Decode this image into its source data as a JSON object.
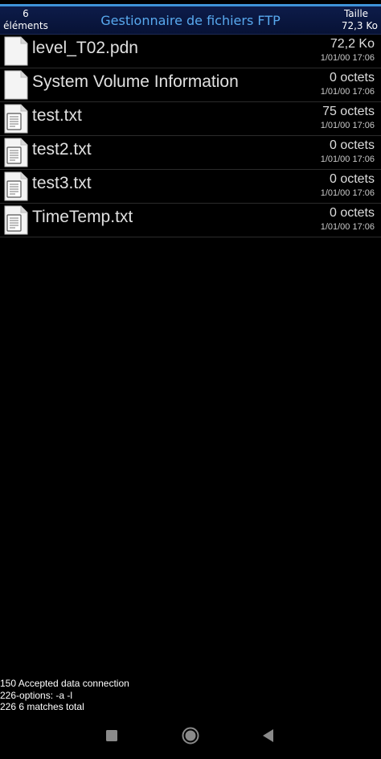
{
  "header": {
    "count_value": "6",
    "count_label": "éléments",
    "title": "Gestionnaire de fichiers FTP",
    "size_label": "Taille",
    "size_value": "72,3 Ko",
    "accent_color": "#58a9ee"
  },
  "files": [
    {
      "name": "level_T02.pdn",
      "size": "72,2 Ko",
      "date": "1/01/00 17:06",
      "icon": "blank-file-icon"
    },
    {
      "name": "System Volume Information",
      "size": "0 octets",
      "date": "1/01/00 17:06",
      "icon": "blank-file-icon"
    },
    {
      "name": "test.txt",
      "size": "75 octets",
      "date": "1/01/00 17:06",
      "icon": "text-file-icon"
    },
    {
      "name": "test2.txt",
      "size": "0 octets",
      "date": "1/01/00 17:06",
      "icon": "text-file-icon"
    },
    {
      "name": "test3.txt",
      "size": "0 octets",
      "date": "1/01/00 17:06",
      "icon": "text-file-icon"
    },
    {
      "name": "TimeTemp.txt",
      "size": "0 octets",
      "date": "1/01/00 17:06",
      "icon": "text-file-icon"
    }
  ],
  "log": {
    "lines": [
      "150 Accepted data connection",
      "226-options: -a -l",
      "226 6 matches total"
    ]
  },
  "navbar": {
    "buttons": [
      "recents-icon",
      "home-icon",
      "back-icon"
    ]
  }
}
